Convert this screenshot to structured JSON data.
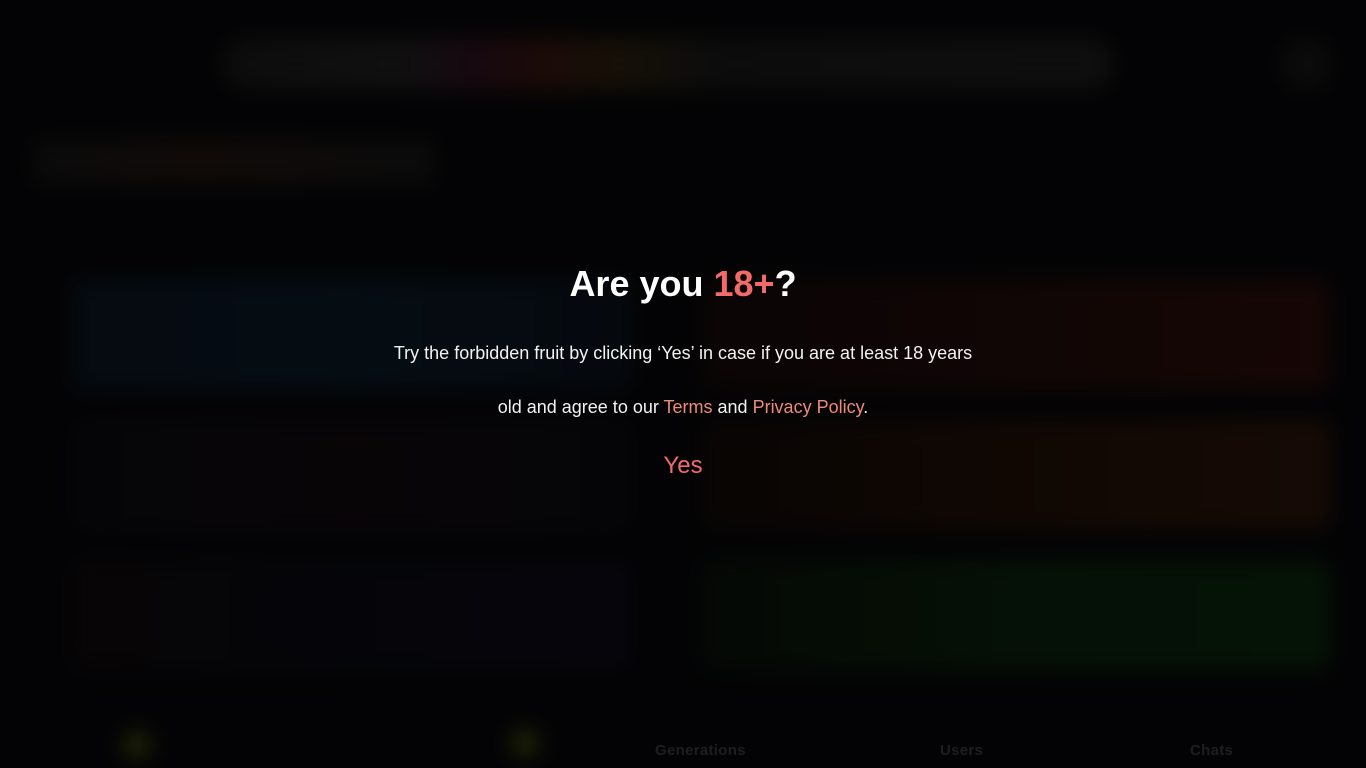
{
  "background": {
    "stats": [
      "Generations",
      "Users",
      "Chats"
    ]
  },
  "modal": {
    "title_prefix": "Are you ",
    "title_accent": "18+",
    "title_suffix": "?",
    "text_before_terms": "Try the forbidden fruit by clicking ‘Yes’ in case if you are at least 18 years old and agree to our ",
    "terms_label": "Terms",
    "text_between": " and ",
    "privacy_label": "Privacy Policy",
    "text_end": ".",
    "yes_label": "Yes"
  },
  "colors": {
    "accent": "#f26a6a",
    "link": "#f08a78",
    "background": "#060608"
  }
}
